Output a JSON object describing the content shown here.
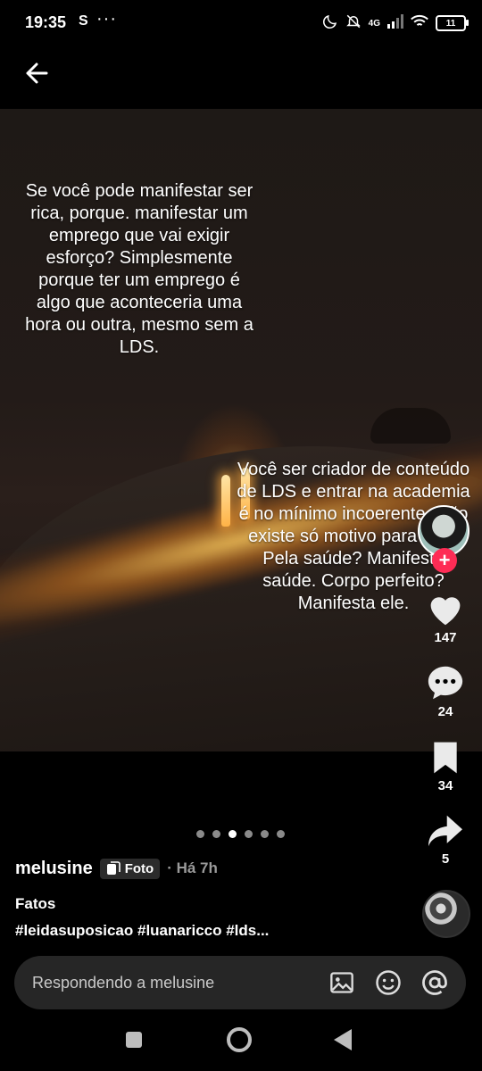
{
  "status_bar": {
    "time": "19:35",
    "carrier_icon": "S",
    "more_dots": "···",
    "network": "4G",
    "battery": "11"
  },
  "post": {
    "text_top": "Se você pode manifestar ser rica, porque. manifestar um emprego que vai exigir esforço? Simplesmente porque ter um emprego é algo que aconteceria uma hora ou outra, mesmo sem a LDS.",
    "text_bottom": "Você ser criador de conteúdo de LDS e entrar na academia é no mínimo incoerente. Não existe só motivo para isso. Pela saúde? Manifeste saúde. Corpo perfeito? Manifesta ele.",
    "carousel_total": 6,
    "carousel_active_index": 2
  },
  "actions": {
    "likes": "147",
    "comments": "24",
    "saves": "34",
    "shares": "5"
  },
  "author": {
    "username": "melusine",
    "badge": "Foto",
    "time_ago": "· Há 7h",
    "caption_title": "Fatos",
    "hashtags": "#leidasuposicao #luanaricco #lds..."
  },
  "reply": {
    "placeholder": "Respondendo a melusine"
  },
  "colors": {
    "accent": "#fe2c55",
    "background": "#000000",
    "reply_bar": "#262626"
  }
}
